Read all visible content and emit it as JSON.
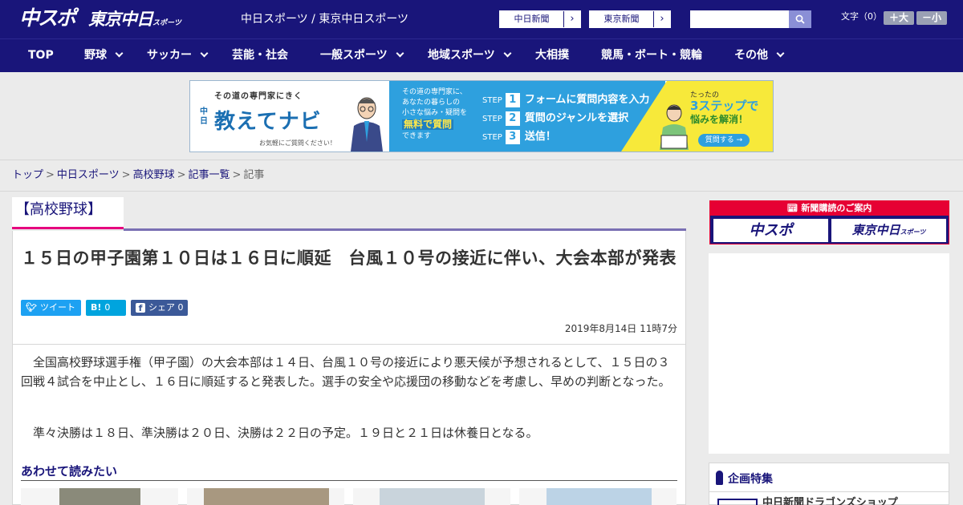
{
  "header": {
    "logo_primary": "中スポ",
    "logo_secondary": "東京中日",
    "logo_secondary_small": "スポーツ",
    "site_title": "中日スポーツ / 東京中日スポーツ",
    "paper_links": [
      {
        "label": "中日新聞"
      },
      {
        "label": "東京新聞"
      }
    ],
    "search": {
      "placeholder": "",
      "value": ""
    },
    "font_size": {
      "label": "文字（0）",
      "increase_label": "＋大",
      "decrease_label": "－小"
    }
  },
  "nav": {
    "items": [
      {
        "label": "TOP",
        "has_dropdown": false
      },
      {
        "label": "野球",
        "has_dropdown": true
      },
      {
        "label": "サッカー",
        "has_dropdown": true
      },
      {
        "label": "芸能・社会",
        "has_dropdown": false
      },
      {
        "label": "一般スポーツ",
        "has_dropdown": true
      },
      {
        "label": "地域スポーツ",
        "has_dropdown": true
      },
      {
        "label": "大相撲",
        "has_dropdown": false
      },
      {
        "label": "競馬・ボート・競輪",
        "has_dropdown": false
      },
      {
        "label": "その他",
        "has_dropdown": true
      }
    ]
  },
  "ad_banner": {
    "tagline": "その道の専門家にきく",
    "brand_prefix": "中日",
    "brand": "教えてナビ",
    "note": "お気軽にご質問ください！",
    "lead_lines": [
      "その道の専門家に、",
      "あなたの暮らしの",
      "小さな悩み・疑問を"
    ],
    "highlight": "無料で質問",
    "lead_tail": "できます",
    "steps": [
      {
        "step": "STEP",
        "num": "1",
        "text": "フォームに質問内容を入力"
      },
      {
        "step": "STEP",
        "num": "2",
        "text": "質問のジャンルを選択"
      },
      {
        "step": "STEP",
        "num": "3",
        "text": "送信！"
      }
    ],
    "cta_small": "たったの",
    "cta_big": "3ステップで",
    "cta_sub": "悩みを解消！",
    "cta_button": "質問する →"
  },
  "breadcrumb": {
    "items": [
      "トップ",
      "中日スポーツ",
      "高校野球",
      "記事一覧"
    ],
    "current": "記事",
    "separator": ">"
  },
  "article": {
    "category": "【高校野球】",
    "headline": "１５日の甲子園第１０日は１６日に順延　台風１０号の接近に伴い、大会本部が発表",
    "share": {
      "tweet_label": "ツイート",
      "hatena_label": "B!",
      "hatena_count": "0",
      "facebook_label": "シェア",
      "facebook_count": "0"
    },
    "date": "2019年8月14日 11時7分",
    "paragraphs": [
      "全国高校野球選手権（甲子園）の大会本部は１４日、台風１０号の接近により悪天候が予想されるとして、１５日の３回戦４試合を中止とし、１６日に順延すると発表した。選手の安全や応援団の移動などを考慮し、早めの判断となった。",
      "準々決勝は１８日、準決勝は２０日、決勝は２２日の予定。１９日と２１日は休養日となる。"
    ],
    "related_title": "あわせて読みたい"
  },
  "sidebar": {
    "subscription_title": "新聞購読のご案内",
    "subscription_buttons": [
      "中スポ",
      "東京中日"
    ],
    "subscription_small": "スポーツ",
    "feature_title": "企画特集",
    "feature_item": "中日新聞ドラゴンズショップ"
  },
  "colors": {
    "brand_navy": "#19157a",
    "accent_pink": "#e6007e",
    "subscription_red": "#e60033",
    "twitter": "#1da1f2",
    "hatena": "#00a4de",
    "facebook": "#3b5998"
  }
}
